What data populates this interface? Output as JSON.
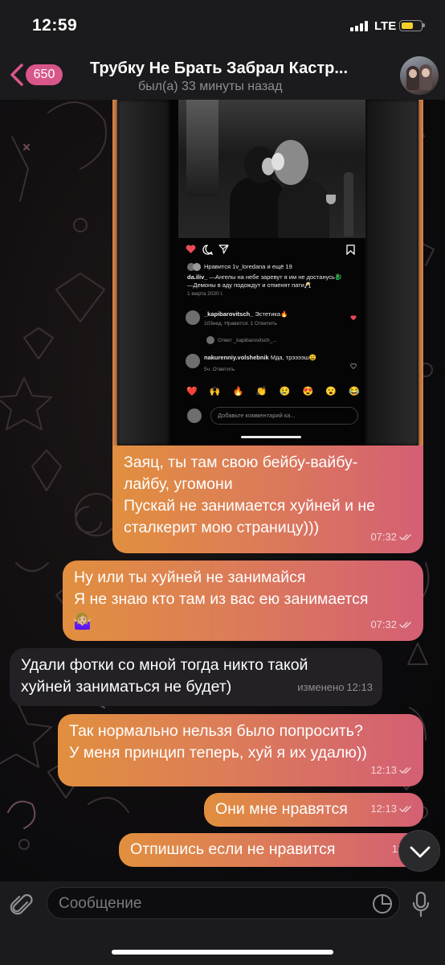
{
  "status_bar": {
    "time": "12:59",
    "network": "LTE"
  },
  "header": {
    "unread_count": "650",
    "title": "Трубку Не Брать Забрал Кастр...",
    "status": "был(а) 33 минуты назад"
  },
  "photo_message": {
    "instagram": {
      "liked_by": "Нравится 1v_loredana и ещё 19",
      "caption_user": "da.iliv_",
      "caption_line1": "—Ангелы на небе заревут я им не достанусь🐉",
      "caption_line2": "—Демоны в аду подождут и отменят пати🥂",
      "date": "1 марта 2020 г.",
      "comments": [
        {
          "user": "_kapibarovitsch_",
          "text": "Эстетика🔥",
          "meta": "103нед.   Нравится: 1   Ответить"
        },
        {
          "user": "",
          "text": "Ответ _kapibarovitsch_...",
          "meta": ""
        },
        {
          "user": "nakurenniy.volshebnik",
          "text": "Мда,  трээээш😩",
          "meta": "5ч.   Ответить"
        }
      ],
      "emoji_bar": [
        "❤️",
        "🙌",
        "🔥",
        "👏",
        "😢",
        "😍",
        "😮",
        "😂"
      ],
      "comment_placeholder": "Добавьте комментарий ка..."
    }
  },
  "messages": [
    {
      "direction": "out",
      "text": "Заяц, ты там свою бейбу-вайбу-\nлайбу, угомони\nПускай не занимается хуйней и не\nсталкерит мою страницу)))",
      "time": "07:32"
    },
    {
      "direction": "out",
      "text": "Ну или ты хуйней не занимайся\nЯ не знаю кто там из вас ею занимается",
      "emoji": "🤷🏼‍♀️",
      "time": "07:32"
    },
    {
      "direction": "in",
      "text": "Удали фотки со мной тогда никто такой\nхуйней заниматься не будет)",
      "edited": "изменено",
      "time": "12:13"
    },
    {
      "direction": "out",
      "text": "Так нормально нельзя было попросить?\nУ меня принцип теперь, хуй я их удалю))",
      "time": "12:13"
    },
    {
      "direction": "out",
      "text": "Они мне нравятся",
      "time": "12:13"
    },
    {
      "direction": "out",
      "text": "Отпишись если не нравится",
      "time": "12:1"
    }
  ],
  "composer": {
    "placeholder": "Сообщение"
  },
  "icons": {
    "back": "chevron-left-icon",
    "attach": "paperclip-icon",
    "sticker": "sticker-icon",
    "mic": "microphone-icon",
    "scroll": "chevron-down-icon",
    "read": "double-check-icon"
  },
  "colors": {
    "accent": "#d9568a",
    "bubble_out_start": "#e18f3f",
    "bubble_out_end": "#d45f74",
    "bubble_in": "#232126",
    "bar_bg": "#1b1b1d"
  }
}
